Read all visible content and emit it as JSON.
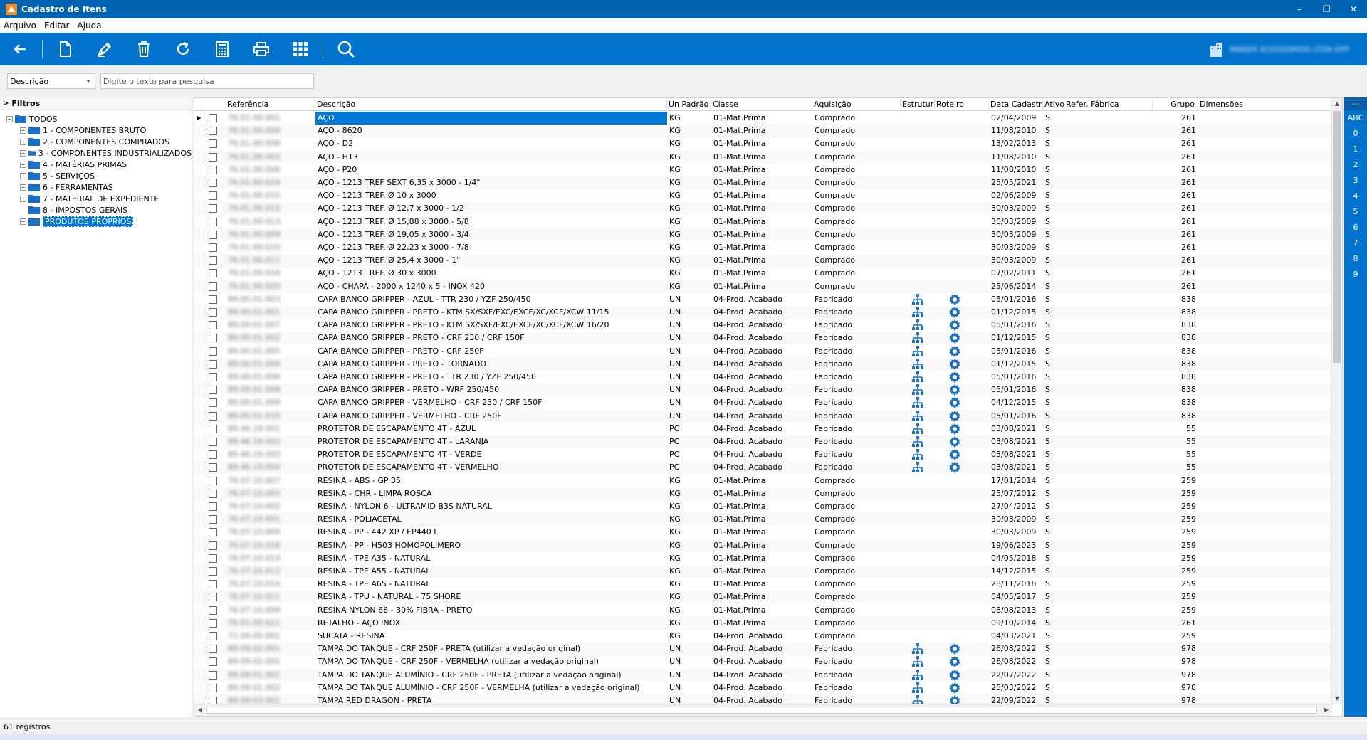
{
  "window": {
    "title": "Cadastro de Itens",
    "minimize": "–",
    "restore": "❐",
    "close": "✕"
  },
  "menu": [
    "Arquivo",
    "Editar",
    "Ajuda"
  ],
  "toolbar": {
    "buttons": [
      "back-icon",
      "new-document-icon",
      "edit-icon",
      "delete-icon",
      "refresh-icon",
      "calculator-icon",
      "print-icon",
      "grid-icon",
      "search-icon"
    ],
    "company_name": "MAKER ACESSORIOS LTDA EPP"
  },
  "search": {
    "field": "Descrição",
    "placeholder": "Digite o texto para pesquisa"
  },
  "filters": {
    "header": "Filtros",
    "root": "TODOS",
    "items": [
      "1 - COMPONENTES BRUTO",
      "2 - COMPONENTES COMPRADOS",
      "3 - COMPONENTES INDUSTRIALIZADOS",
      "4 - MATÉRIAS PRIMAS",
      "5 - SERVIÇOS",
      "6 - FERRAMENTAS",
      "7 - MATERIAL DE EXPEDIENTE",
      "8 - IMPOSTOS GERAIS",
      "PRODUTOS PRÓPRIOS"
    ]
  },
  "columns": [
    "Referência",
    "Descrição",
    "Un Padrão",
    "Classe",
    "Aquisição",
    "Estrutura",
    "Roteiro",
    "Data Cadastro",
    "Ativo",
    "Refer. Fábrica",
    "Grupo",
    "Dimensões"
  ],
  "rows": [
    {
      "ref": "76.01.00.001",
      "desc": "AÇO",
      "un": "KG",
      "classe": "01-Mat.Prima",
      "aq": "Comprado",
      "date": "02/04/2009",
      "ativo": "S",
      "grupo": "261",
      "icons": false
    },
    {
      "ref": "76.01.00.004",
      "desc": "AÇO -  8620",
      "un": "KG",
      "classe": "01-Mat.Prima",
      "aq": "Comprado",
      "date": "11/08/2010",
      "ativo": "S",
      "grupo": "261",
      "icons": false
    },
    {
      "ref": "76.01.00.008",
      "desc": "AÇO -  D2",
      "un": "KG",
      "classe": "01-Mat.Prima",
      "aq": "Comprado",
      "date": "13/02/2013",
      "ativo": "S",
      "grupo": "261",
      "icons": false
    },
    {
      "ref": "76.01.00.003",
      "desc": "AÇO -  H13",
      "un": "KG",
      "classe": "01-Mat.Prima",
      "aq": "Comprado",
      "date": "11/08/2010",
      "ativo": "S",
      "grupo": "261",
      "icons": false
    },
    {
      "ref": "76.01.00.006",
      "desc": "AÇO -  P20",
      "un": "KG",
      "classe": "01-Mat.Prima",
      "aq": "Comprado",
      "date": "11/08/2010",
      "ativo": "S",
      "grupo": "261",
      "icons": false
    },
    {
      "ref": "76.01.00.024",
      "desc": "AÇO - 1213 TREF SEXT 6,35 x 3000 - 1/4\"",
      "un": "KG",
      "classe": "01-Mat.Prima",
      "aq": "Comprado",
      "date": "25/05/2021",
      "ativo": "S",
      "grupo": "261",
      "icons": false
    },
    {
      "ref": "76.01.00.015",
      "desc": "AÇO - 1213 TREF. Ø 10 x 3000",
      "un": "KG",
      "classe": "01-Mat.Prima",
      "aq": "Comprado",
      "date": "02/06/2009",
      "ativo": "S",
      "grupo": "261",
      "icons": false
    },
    {
      "ref": "76.01.00.012",
      "desc": "AÇO - 1213 TREF. Ø 12,7 x 3000 - 1/2",
      "un": "KG",
      "classe": "01-Mat.Prima",
      "aq": "Comprado",
      "date": "30/03/2009",
      "ativo": "S",
      "grupo": "261",
      "icons": false
    },
    {
      "ref": "76.01.00.013",
      "desc": "AÇO - 1213 TREF. Ø 15,88 x 3000 - 5/8",
      "un": "KG",
      "classe": "01-Mat.Prima",
      "aq": "Comprado",
      "date": "30/03/2009",
      "ativo": "S",
      "grupo": "261",
      "icons": false
    },
    {
      "ref": "76.01.00.009",
      "desc": "AÇO - 1213 TREF. Ø 19,05 x 3000 - 3/4",
      "un": "KG",
      "classe": "01-Mat.Prima",
      "aq": "Comprado",
      "date": "30/03/2009",
      "ativo": "S",
      "grupo": "261",
      "icons": false
    },
    {
      "ref": "76.01.00.010",
      "desc": "AÇO - 1213 TREF. Ø 22,23 x 3000 - 7/8",
      "un": "KG",
      "classe": "01-Mat.Prima",
      "aq": "Comprado",
      "date": "30/03/2009",
      "ativo": "S",
      "grupo": "261",
      "icons": false
    },
    {
      "ref": "76.01.00.011",
      "desc": "AÇO - 1213 TREF. Ø 25,4 x 3000 - 1\"",
      "un": "KG",
      "classe": "01-Mat.Prima",
      "aq": "Comprado",
      "date": "30/03/2009",
      "ativo": "S",
      "grupo": "261",
      "icons": false
    },
    {
      "ref": "76.01.00.016",
      "desc": "AÇO - 1213 TREF. Ø 30 x 3000",
      "un": "KG",
      "classe": "01-Mat.Prima",
      "aq": "Comprado",
      "date": "07/02/2011",
      "ativo": "S",
      "grupo": "261",
      "icons": false
    },
    {
      "ref": "76.01.00.020",
      "desc": "AÇO - CHAPA - 2000 x 1240 x 5 - INOX 420",
      "un": "KG",
      "classe": "01-Mat.Prima",
      "aq": "Comprado",
      "date": "25/06/2014",
      "ativo": "S",
      "grupo": "261",
      "icons": false
    },
    {
      "ref": "89.00.01.003",
      "desc": "CAPA BANCO GRIPPER - AZUL - TTR 230 / YZF 250/450",
      "un": "UN",
      "classe": "04-Prod. Acabado",
      "aq": "Fabricado",
      "date": "05/01/2016",
      "ativo": "S",
      "grupo": "838",
      "icons": true
    },
    {
      "ref": "89.00.01.001",
      "desc": "CAPA BANCO GRIPPER - PRETO -  KTM SX/SXF/EXC/EXCF/XC/XCF/XCW 11/15",
      "un": "UN",
      "classe": "04-Prod. Acabado",
      "aq": "Fabricado",
      "date": "01/12/2015",
      "ativo": "S",
      "grupo": "838",
      "icons": true
    },
    {
      "ref": "89.00.01.007",
      "desc": "CAPA BANCO GRIPPER - PRETO -  KTM SX/SXF/EXC/EXCF/XC/XCF/XCW 16/20",
      "un": "UN",
      "classe": "04-Prod. Acabado",
      "aq": "Fabricado",
      "date": "05/01/2016",
      "ativo": "S",
      "grupo": "838",
      "icons": true
    },
    {
      "ref": "89.00.01.002",
      "desc": "CAPA BANCO GRIPPER - PRETO - CRF 230 / CRF 150F",
      "un": "UN",
      "classe": "04-Prod. Acabado",
      "aq": "Fabricado",
      "date": "01/12/2015",
      "ativo": "S",
      "grupo": "838",
      "icons": true
    },
    {
      "ref": "89.00.01.005",
      "desc": "CAPA BANCO GRIPPER - PRETO - CRF 250F",
      "un": "UN",
      "classe": "04-Prod. Acabado",
      "aq": "Fabricado",
      "date": "05/01/2016",
      "ativo": "S",
      "grupo": "838",
      "icons": true
    },
    {
      "ref": "89.00.01.004",
      "desc": "CAPA BANCO GRIPPER - PRETO - TORNADO",
      "un": "UN",
      "classe": "04-Prod. Acabado",
      "aq": "Fabricado",
      "date": "01/12/2015",
      "ativo": "S",
      "grupo": "838",
      "icons": true
    },
    {
      "ref": "89.00.01.006",
      "desc": "CAPA BANCO GRIPPER - PRETO - TTR 230 / YZF 250/450",
      "un": "UN",
      "classe": "04-Prod. Acabado",
      "aq": "Fabricado",
      "date": "05/01/2016",
      "ativo": "S",
      "grupo": "838",
      "icons": true
    },
    {
      "ref": "89.00.01.008",
      "desc": "CAPA BANCO GRIPPER - PRETO - WRF 250/450",
      "un": "UN",
      "classe": "04-Prod. Acabado",
      "aq": "Fabricado",
      "date": "05/01/2016",
      "ativo": "S",
      "grupo": "838",
      "icons": true
    },
    {
      "ref": "89.00.01.009",
      "desc": "CAPA BANCO GRIPPER - VERMELHO - CRF 230 / CRF 150F",
      "un": "UN",
      "classe": "04-Prod. Acabado",
      "aq": "Fabricado",
      "date": "04/12/2015",
      "ativo": "S",
      "grupo": "838",
      "icons": true
    },
    {
      "ref": "89.00.01.010",
      "desc": "CAPA BANCO GRIPPER - VERMELHO - CRF 250F",
      "un": "UN",
      "classe": "04-Prod. Acabado",
      "aq": "Fabricado",
      "date": "05/01/2016",
      "ativo": "S",
      "grupo": "838",
      "icons": true
    },
    {
      "ref": "89.46.19.001",
      "desc": "PROTETOR DE ESCAPAMENTO 4T - AZUL",
      "un": "PC",
      "classe": "04-Prod. Acabado",
      "aq": "Fabricado",
      "date": "03/08/2021",
      "ativo": "S",
      "grupo": "55",
      "icons": true
    },
    {
      "ref": "89.46.19.002",
      "desc": "PROTETOR DE ESCAPAMENTO 4T - LARANJA",
      "un": "PC",
      "classe": "04-Prod. Acabado",
      "aq": "Fabricado",
      "date": "03/08/2021",
      "ativo": "S",
      "grupo": "55",
      "icons": true
    },
    {
      "ref": "89.46.19.003",
      "desc": "PROTETOR DE ESCAPAMENTO 4T - VERDE",
      "un": "PC",
      "classe": "04-Prod. Acabado",
      "aq": "Fabricado",
      "date": "03/08/2021",
      "ativo": "S",
      "grupo": "55",
      "icons": true
    },
    {
      "ref": "89.46.19.004",
      "desc": "PROTETOR DE ESCAPAMENTO 4T - VERMELHO",
      "un": "PC",
      "classe": "04-Prod. Acabado",
      "aq": "Fabricado",
      "date": "03/08/2021",
      "ativo": "S",
      "grupo": "55",
      "icons": true
    },
    {
      "ref": "76.07.10.007",
      "desc": "RESINA - ABS - GP 35",
      "un": "KG",
      "classe": "01-Mat.Prima",
      "aq": "Comprado",
      "date": "17/01/2014",
      "ativo": "S",
      "grupo": "259",
      "icons": false
    },
    {
      "ref": "76.07.10.003",
      "desc": "RESINA - CHR - LIMPA ROSCA",
      "un": "KG",
      "classe": "01-Mat.Prima",
      "aq": "Comprado",
      "date": "25/07/2012",
      "ativo": "S",
      "grupo": "259",
      "icons": false
    },
    {
      "ref": "76.07.10.002",
      "desc": "RESINA - NYLON 6 - ULTRAMID B3S  NATURAL",
      "un": "KG",
      "classe": "01-Mat.Prima",
      "aq": "Comprado",
      "date": "27/04/2012",
      "ativo": "S",
      "grupo": "259",
      "icons": false
    },
    {
      "ref": "76.07.10.001",
      "desc": "RESINA - POLIACETAL",
      "un": "KG",
      "classe": "01-Mat.Prima",
      "aq": "Comprado",
      "date": "30/03/2009",
      "ativo": "S",
      "grupo": "259",
      "icons": false
    },
    {
      "ref": "76.07.10.004",
      "desc": "RESINA - PP - 442 XP / EP440 L",
      "un": "KG",
      "classe": "01-Mat.Prima",
      "aq": "Comprado",
      "date": "30/03/2009",
      "ativo": "S",
      "grupo": "259",
      "icons": false
    },
    {
      "ref": "76.07.10.016",
      "desc": "RESINA - PP - H503 HOMOPOLÍMERO",
      "un": "KG",
      "classe": "01-Mat.Prima",
      "aq": "Comprado",
      "date": "19/06/2023",
      "ativo": "S",
      "grupo": "259",
      "icons": false
    },
    {
      "ref": "76.07.10.013",
      "desc": "RESINA - TPE A35 - NATURAL",
      "un": "KG",
      "classe": "01-Mat.Prima",
      "aq": "Comprado",
      "date": "04/05/2018",
      "ativo": "S",
      "grupo": "259",
      "icons": false
    },
    {
      "ref": "76.07.10.012",
      "desc": "RESINA - TPE A55 - NATURAL",
      "un": "KG",
      "classe": "01-Mat.Prima",
      "aq": "Comprado",
      "date": "14/12/2015",
      "ativo": "S",
      "grupo": "259",
      "icons": false
    },
    {
      "ref": "76.07.10.014",
      "desc": "RESINA - TPE A65 - NATURAL",
      "un": "KG",
      "classe": "01-Mat.Prima",
      "aq": "Comprado",
      "date": "28/11/2018",
      "ativo": "S",
      "grupo": "259",
      "icons": false
    },
    {
      "ref": "76.07.10.011",
      "desc": "RESINA - TPU - NATURAL - 75 SHORE",
      "un": "KG",
      "classe": "01-Mat.Prima",
      "aq": "Comprado",
      "date": "04/05/2017",
      "ativo": "S",
      "grupo": "259",
      "icons": false
    },
    {
      "ref": "76.07.10.008",
      "desc": "RESINA NYLON 66 - 30% FIBRA - PRETO",
      "un": "KG",
      "classe": "01-Mat.Prima",
      "aq": "Comprado",
      "date": "08/08/2013",
      "ativo": "S",
      "grupo": "259",
      "icons": false
    },
    {
      "ref": "76.01.00.021",
      "desc": "RETALHO - AÇO INOX",
      "un": "KG",
      "classe": "01-Mat.Prima",
      "aq": "Comprado",
      "date": "09/10/2014",
      "ativo": "S",
      "grupo": "261",
      "icons": false
    },
    {
      "ref": "71.00.00.001",
      "desc": "SUCATA - RESINA",
      "un": "KG",
      "classe": "04-Prod. Acabado",
      "aq": "Comprado",
      "date": "04/03/2021",
      "ativo": "S",
      "grupo": "259",
      "icons": false
    },
    {
      "ref": "89.09.02.001",
      "desc": "TAMPA DO TANQUE - CRF 250F - PRETA (utilizar a vedação original)",
      "un": "UN",
      "classe": "04-Prod. Acabado",
      "aq": "Fabricado",
      "date": "26/08/2022",
      "ativo": "S",
      "grupo": "978",
      "icons": true
    },
    {
      "ref": "89.09.02.002",
      "desc": "TAMPA DO TANQUE - CRF 250F - VERMELHA (utilizar a vedação original)",
      "un": "UN",
      "classe": "04-Prod. Acabado",
      "aq": "Fabricado",
      "date": "26/08/2022",
      "ativo": "S",
      "grupo": "978",
      "icons": true
    },
    {
      "ref": "89.09.01.001",
      "desc": "TAMPA DO TANQUE ALUMÍNIO - CRF 250F - PRETA (utilizar a vedação original)",
      "un": "UN",
      "classe": "04-Prod. Acabado",
      "aq": "Fabricado",
      "date": "22/07/2022",
      "ativo": "S",
      "grupo": "978",
      "icons": true
    },
    {
      "ref": "89.09.01.002",
      "desc": "TAMPA DO TANQUE ALUMÍNIO - CRF 250F - VERMELHA (utilizar a vedação original)",
      "un": "UN",
      "classe": "04-Prod. Acabado",
      "aq": "Fabricado",
      "date": "25/03/2022",
      "ativo": "S",
      "grupo": "978",
      "icons": true
    },
    {
      "ref": "89.09.03.001",
      "desc": "TAMPA RED DRAGON -  PRETA",
      "un": "UN",
      "classe": "04-Prod. Acabado",
      "aq": "Fabricado",
      "date": "22/09/2022",
      "ativo": "S",
      "grupo": "978",
      "icons": true
    }
  ],
  "alpha_index": {
    "top": "...",
    "items": [
      "ABC",
      "0",
      "1",
      "2",
      "3",
      "4",
      "5",
      "6",
      "7",
      "8",
      "9"
    ]
  },
  "status": "61 registros",
  "colors": {
    "title_bar": "#0063b1",
    "toolbar": "#0173cd",
    "selection": "#0078d7",
    "icon_blue": "#1a6fc6"
  }
}
